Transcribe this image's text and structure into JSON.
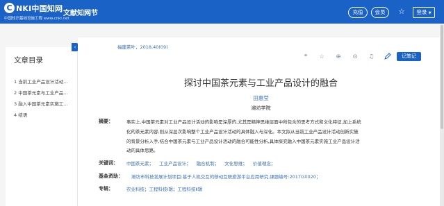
{
  "header": {
    "logo_mark": "C",
    "logo_main": "NKI中国知网",
    "logo_sub": "中国知识基础设施工程",
    "logo_url": "www.cnki.net",
    "site_name": "文献知网节",
    "recharge_label": "充值",
    "member_label": "会员",
    "fav_icon": "☆",
    "login_label": "登录",
    "login_caret": "▼",
    "brand_color": "#1a62c6"
  },
  "sidebar": {
    "title": "文章目录",
    "toggle_icon": "‹",
    "items": [
      {
        "label": "1 当前工业产品设计活动…"
      },
      {
        "label": "2 中国茶元素与工业产品…"
      },
      {
        "label": "3 融入中国茶元素实施工…"
      },
      {
        "label": "4 结语"
      }
    ]
  },
  "article": {
    "journal": "福建茶叶，2018,40(09)",
    "tools": [
      {
        "icon": "quote-icon",
        "glyph": "❝"
      },
      {
        "icon": "star-icon",
        "glyph": "☆"
      },
      {
        "icon": "share-icon",
        "glyph": "⊕"
      },
      {
        "icon": "mindmap-icon",
        "glyph": "⊙"
      },
      {
        "icon": "bell-icon",
        "glyph": "♫"
      }
    ],
    "note_button": "记笔记",
    "title": "探讨中国茶元素与工业产品设计的融合",
    "author": "田惠莹",
    "affiliation": "潍坊学院",
    "abstract_label": "摘要：",
    "abstract_lines": [
      "事实上,中国茶元素对工业产品设计活动的影响是深厚的,尤其是精神思维层面中所包含的思考方式和文化特征,加上系统",
      "化的茶元素内容,则从深层次影响整个工业产品设计活动的具体融入与深化。本文拟从当前工业产品设计活动创新实施",
      "的背景分析入手,结合中国茶元素与工业产品设计活动的融合可能性分析,具体探究融入中国茶元素实施工业产品设计活",
      "动的具体思路。"
    ],
    "keywords_label": "关键词：",
    "keywords": [
      "中国茶元素；",
      "工业产品设计；",
      "融合机制；",
      "文化思维；",
      "价值理念；"
    ],
    "fund_label": "基金资助：",
    "fund": "潍坊市科技发展计划项目:基于人机交互的移动互联旅游平台应用研究,课题编号:2017GX020；",
    "subject_label": "专辑：",
    "subject": "农业科技；工程科技Ⅰ辑；工程科技Ⅱ辑"
  }
}
